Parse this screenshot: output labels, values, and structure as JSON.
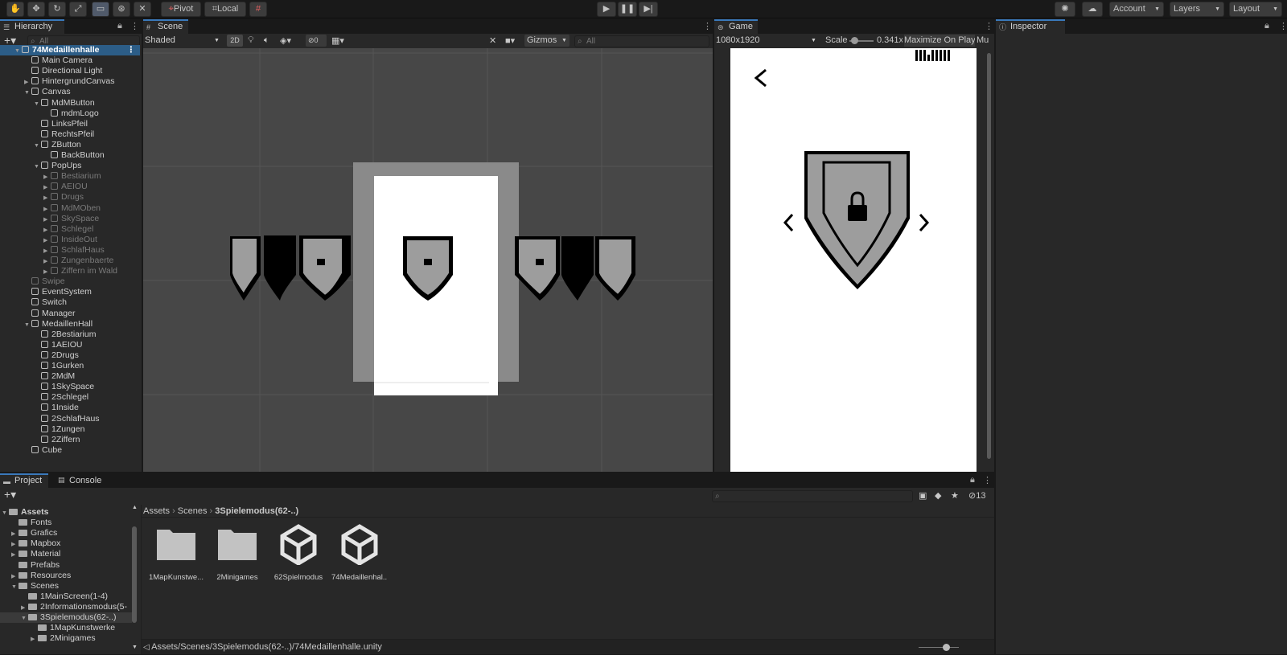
{
  "toolbar": {
    "pivot_label": "Pivot",
    "local_label": "Local",
    "account_label": "Account",
    "layers_label": "Layers",
    "layout_label": "Layout",
    "tool_icons": [
      "hand-icon",
      "move-icon",
      "rotate-icon",
      "scale-icon",
      "rect-icon",
      "transform-icon",
      "custom-tool-icon"
    ]
  },
  "hierarchy": {
    "tab": "Hierarchy",
    "search_placeholder": "All",
    "items": [
      {
        "label": "74Medaillenhalle",
        "indent": 0,
        "fold": "open",
        "type": "scene",
        "selected": true
      },
      {
        "label": "Main Camera",
        "indent": 1,
        "fold": "none"
      },
      {
        "label": "Directional Light",
        "indent": 1,
        "fold": "none"
      },
      {
        "label": "HintergrundCanvas",
        "indent": 1,
        "fold": "closed"
      },
      {
        "label": "Canvas",
        "indent": 1,
        "fold": "open"
      },
      {
        "label": "MdMButton",
        "indent": 2,
        "fold": "open"
      },
      {
        "label": "mdmLogo",
        "indent": 3,
        "fold": "none"
      },
      {
        "label": "LinksPfeil",
        "indent": 2,
        "fold": "none"
      },
      {
        "label": "RechtsPfeil",
        "indent": 2,
        "fold": "none"
      },
      {
        "label": "ZButton",
        "indent": 2,
        "fold": "open"
      },
      {
        "label": "BackButton",
        "indent": 3,
        "fold": "none"
      },
      {
        "label": "PopUps",
        "indent": 2,
        "fold": "open"
      },
      {
        "label": "Bestiarium",
        "indent": 3,
        "fold": "closed",
        "dim": true
      },
      {
        "label": "AEIOU",
        "indent": 3,
        "fold": "closed",
        "dim": true
      },
      {
        "label": "Drugs",
        "indent": 3,
        "fold": "closed",
        "dim": true
      },
      {
        "label": "MdMOben",
        "indent": 3,
        "fold": "closed",
        "dim": true
      },
      {
        "label": "SkySpace",
        "indent": 3,
        "fold": "closed",
        "dim": true
      },
      {
        "label": "Schlegel",
        "indent": 3,
        "fold": "closed",
        "dim": true
      },
      {
        "label": "InsideOut",
        "indent": 3,
        "fold": "closed",
        "dim": true
      },
      {
        "label": "SchlafHaus",
        "indent": 3,
        "fold": "closed",
        "dim": true
      },
      {
        "label": "Zungenbaerte",
        "indent": 3,
        "fold": "closed",
        "dim": true
      },
      {
        "label": "Ziffern im Wald",
        "indent": 3,
        "fold": "closed",
        "dim": true
      },
      {
        "label": "Swipe",
        "indent": 1,
        "fold": "none",
        "dim": true
      },
      {
        "label": "EventSystem",
        "indent": 1,
        "fold": "none"
      },
      {
        "label": "Switch",
        "indent": 1,
        "fold": "none"
      },
      {
        "label": "Manager",
        "indent": 1,
        "fold": "none"
      },
      {
        "label": "MedaillenHall",
        "indent": 1,
        "fold": "open"
      },
      {
        "label": "2Bestiarium",
        "indent": 2,
        "fold": "none"
      },
      {
        "label": "1AEIOU",
        "indent": 2,
        "fold": "none"
      },
      {
        "label": "2Drugs",
        "indent": 2,
        "fold": "none"
      },
      {
        "label": "1Gurken",
        "indent": 2,
        "fold": "none"
      },
      {
        "label": "2MdM",
        "indent": 2,
        "fold": "none"
      },
      {
        "label": "1SkySpace",
        "indent": 2,
        "fold": "none"
      },
      {
        "label": "2Schlegel",
        "indent": 2,
        "fold": "none"
      },
      {
        "label": "1Inside",
        "indent": 2,
        "fold": "none"
      },
      {
        "label": "2SchlafHaus",
        "indent": 2,
        "fold": "none"
      },
      {
        "label": "1Zungen",
        "indent": 2,
        "fold": "none"
      },
      {
        "label": "2Ziffern",
        "indent": 2,
        "fold": "none"
      },
      {
        "label": "Cube",
        "indent": 1,
        "fold": "none"
      }
    ]
  },
  "scene": {
    "tab": "Scene",
    "shading": "Shaded",
    "mode_2d": "2D",
    "hidden_count": "0",
    "gizmos": "Gizmos",
    "search_placeholder": "All"
  },
  "game": {
    "tab": "Game",
    "resolution": "1080x1920",
    "scale_label": "Scale",
    "scale_value": "0.341x",
    "maximize": "Maximize On Play",
    "mute": "Mu"
  },
  "inspector": {
    "tab": "Inspector"
  },
  "project": {
    "tab_project": "Project",
    "tab_console": "Console",
    "hidden_count": "13",
    "breadcrumb": [
      "Assets",
      "Scenes",
      "3Spielemodus(62-..)"
    ],
    "tree": [
      {
        "label": "Assets",
        "indent": 0,
        "fold": "open",
        "bold": true
      },
      {
        "label": "Fonts",
        "indent": 1,
        "fold": "none"
      },
      {
        "label": "Grafics",
        "indent": 1,
        "fold": "closed"
      },
      {
        "label": "Mapbox",
        "indent": 1,
        "fold": "closed"
      },
      {
        "label": "Material",
        "indent": 1,
        "fold": "closed"
      },
      {
        "label": "Prefabs",
        "indent": 1,
        "fold": "none"
      },
      {
        "label": "Resources",
        "indent": 1,
        "fold": "closed"
      },
      {
        "label": "Scenes",
        "indent": 1,
        "fold": "open"
      },
      {
        "label": "1MainScreen(1-4)",
        "indent": 2,
        "fold": "none"
      },
      {
        "label": "2Informationsmodus(5-",
        "indent": 2,
        "fold": "closed"
      },
      {
        "label": "3Spielemodus(62-..)",
        "indent": 2,
        "fold": "open",
        "selected": true
      },
      {
        "label": "1MapKunstwerke",
        "indent": 3,
        "fold": "none"
      },
      {
        "label": "2Minigames",
        "indent": 3,
        "fold": "closed"
      }
    ],
    "assets": [
      {
        "label": "1MapKunstwe...",
        "kind": "folder"
      },
      {
        "label": "2Minigames",
        "kind": "folder"
      },
      {
        "label": "62Spielmodus",
        "kind": "unity"
      },
      {
        "label": "74Medaillenhal...",
        "kind": "unity"
      }
    ],
    "status_path": "Assets/Scenes/3Spielemodus(62-..)/74Medaillenhalle.unity"
  }
}
